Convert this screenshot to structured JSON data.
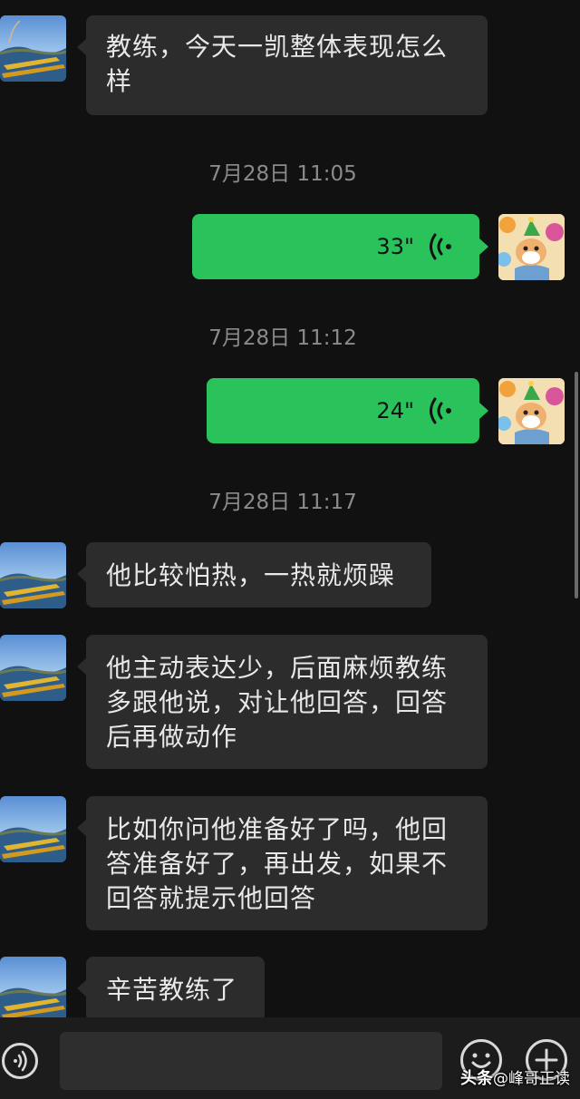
{
  "messages": [
    {
      "from": "other",
      "text": "教练，今天一凯整体表现怎么样"
    },
    {
      "time": "7月28日 11:05"
    },
    {
      "from": "me",
      "type": "voice",
      "duration": "33\""
    },
    {
      "time": "7月28日 11:12"
    },
    {
      "from": "me",
      "type": "voice",
      "duration": "24\""
    },
    {
      "time": "7月28日 11:17"
    },
    {
      "from": "other",
      "text": "他比较怕热，一热就烦躁"
    },
    {
      "from": "other",
      "text": "他主动表达少，后面麻烦教练多跟他说，对让他回答，回答后再做动作"
    },
    {
      "from": "other",
      "text": "比如你问他准备好了吗，他回答准备好了，再出发，如果不回答就提示他回答"
    },
    {
      "from": "other",
      "text": "辛苦教练了"
    }
  ],
  "input_bar": {
    "voice_icon": "voice-input-icon",
    "emoji_icon": "emoji-icon",
    "plus_icon": "plus-icon"
  },
  "watermark": {
    "brand": "头条",
    "text": "@峰哥正读"
  },
  "colors": {
    "background": "#111111",
    "incoming_bubble": "#2c2c2c",
    "outgoing_bubble": "#2ac35b",
    "timestamp": "#8b8b8b"
  }
}
